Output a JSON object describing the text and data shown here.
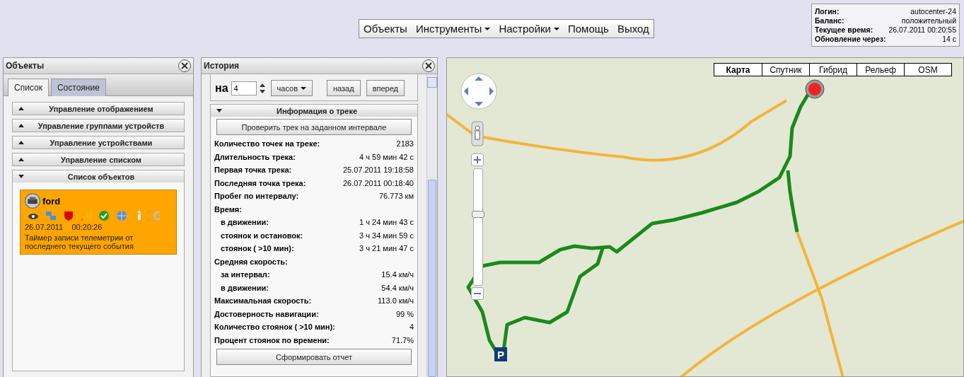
{
  "menu": [
    {
      "label": "Объекты",
      "dropdown": false
    },
    {
      "label": "Инструменты",
      "dropdown": true
    },
    {
      "label": "Настройки",
      "dropdown": true
    },
    {
      "label": "Помощь",
      "dropdown": false
    },
    {
      "label": "Выход",
      "dropdown": false
    }
  ],
  "account": [
    {
      "label": "Логин:",
      "value": "autocenter-24"
    },
    {
      "label": "Баланс:",
      "value": "положительный"
    },
    {
      "label": "Текущее время:",
      "value": "26.07.2011 00:20:55"
    },
    {
      "label": "Обновление через:",
      "value": "14 с"
    }
  ],
  "objects_panel": {
    "title": "Объекты",
    "tabs": [
      {
        "label": "Список",
        "selected": true
      },
      {
        "label": "Состояние",
        "selected": false
      }
    ],
    "sections": [
      {
        "title": "Управление отображением",
        "expanded": false
      },
      {
        "title": "Управление группами устройств",
        "expanded": false
      },
      {
        "title": "Управление устройствами",
        "expanded": false
      },
      {
        "title": "Управление списком",
        "expanded": false
      },
      {
        "title": "Список объектов",
        "expanded": true
      }
    ],
    "object": {
      "name": "ford",
      "date": "26.07.2011",
      "time": "00:20:26",
      "message": "Таймер записи телеметрии от последнего текущего события"
    }
  },
  "history_panel": {
    "title": "История",
    "shift_prefix": "на",
    "shift_value": "4",
    "unit": "часов",
    "buttons": [
      "назад",
      "вперед"
    ],
    "track_info": {
      "title": "Информация о треке",
      "expanded": true,
      "check_button": "Проверить трек на заданном интервале",
      "rows": [
        {
          "label": "Количество точек на треке:",
          "value": "2183"
        },
        {
          "label": "Длительность трека:",
          "value": "4 ч 59 мин 42 с"
        },
        {
          "label": "Первая точка трека:",
          "value": "25.07.2011 19:18:58"
        },
        {
          "label": "Последняя точка трека:",
          "value": "26.07.2011 00:18:40"
        },
        {
          "label": "Пробег по интервалу:",
          "value": "76.773 км"
        },
        {
          "label": "Время:",
          "children": [
            {
              "label": "в движении:",
              "value": "1 ч 24 мин 43 с"
            },
            {
              "label": "стоянок и остановок:",
              "value": "3 ч 34 мин 59 с"
            },
            {
              "label": "стоянок ( >10 мин):",
              "value": "3 ч 21 мин 47 с"
            }
          ]
        },
        {
          "label": "Средняя скорость:",
          "children": [
            {
              "label": "за интервал:",
              "value": "15.4 км/ч"
            },
            {
              "label": "в движении:",
              "value": "54.4 км/ч"
            }
          ]
        },
        {
          "label": "Максимальная скорость:",
          "value": "113.0 км/ч"
        },
        {
          "label": "Достоверность навигации:",
          "value": "99 %"
        },
        {
          "label": "Количество стоянок ( >10 мин):",
          "value": "4"
        },
        {
          "label": "Процент стоянок по времени:",
          "value": "71.7%"
        }
      ],
      "report_button": "Сформировать отчет"
    }
  },
  "map": {
    "types": [
      {
        "label": "Карта",
        "selected": true
      },
      {
        "label": "Спутник",
        "selected": false
      },
      {
        "label": "Гибрид",
        "selected": false
      },
      {
        "label": "Рельеф",
        "selected": false
      },
      {
        "label": "OSM",
        "selected": false
      }
    ],
    "zoom": {
      "level": 0.62
    },
    "parking_marker": "P"
  }
}
